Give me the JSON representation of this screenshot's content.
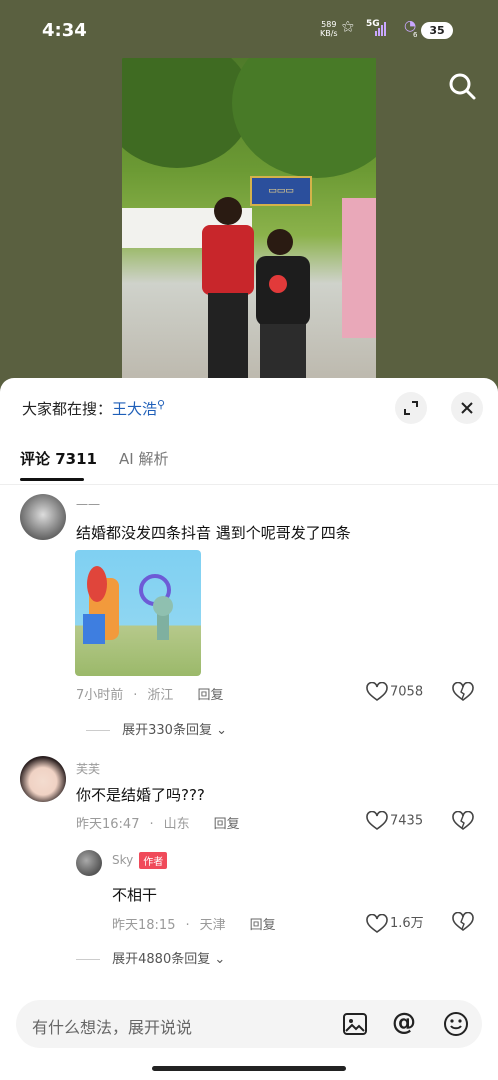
{
  "status": {
    "time": "4:34",
    "net_rate": "589",
    "net_unit": "KB/s",
    "network": "5G",
    "signal_sub": "6",
    "battery": "35"
  },
  "panel": {
    "search_prefix": "大家都在搜：",
    "search_keyword": "王大浩",
    "tabs": [
      {
        "label": "评论 7311"
      },
      {
        "label": "AI 解析"
      }
    ]
  },
  "comments": [
    {
      "user": "一一",
      "text": "结婚都没发四条抖音 遇到个呢哥发了四条",
      "time": "7小时前",
      "location": "浙江",
      "reply": "回复",
      "likes": "7058",
      "expand": "展开330条回复"
    },
    {
      "user": "芙芙",
      "text": "你不是结婚了吗???",
      "time": "昨天16:47",
      "location": "山东",
      "reply": "回复",
      "likes": "7435",
      "sub": {
        "user": "Sky",
        "badge": "作者",
        "text": "不相干",
        "time": "昨天18:15",
        "location": "天津",
        "reply": "回复",
        "likes": "1.6万"
      },
      "expand": "展开4880条回复"
    }
  ],
  "input": {
    "placeholder": "有什么想法，展开说说"
  },
  "icons": [
    "search-icon",
    "expand-icon",
    "close-icon",
    "heart-icon",
    "dislike-heart-icon",
    "chevron-down-icon",
    "image-icon",
    "at-icon",
    "emoji-icon"
  ]
}
